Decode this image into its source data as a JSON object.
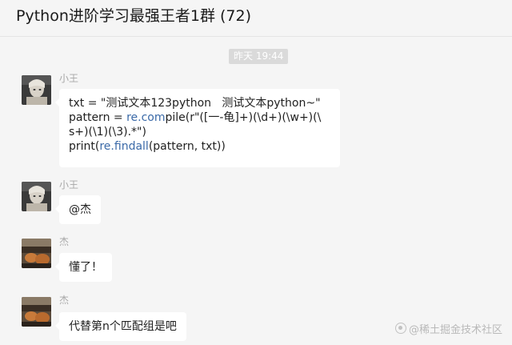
{
  "header": {
    "title": "Python进阶学习最强王者1群 (72)"
  },
  "time_divider": "昨天 19:44",
  "messages": [
    {
      "sender": "小王",
      "avatar": "user-avatar-xiaowang",
      "code": {
        "line1": "txt = \"测试文本123python   测试文本python~\"",
        "line2_pre": "pattern = ",
        "line2_link": "re.com",
        "line2_post": "pile(r\"([一-龟]+)(\\d+)(\\w+)(\\",
        "line3": "s+)(\\1)(\\3).*\")",
        "line4_pre": "print(",
        "line4_link": "re.findall",
        "line4_post": "(pattern, txt))"
      }
    },
    {
      "sender": "小王",
      "avatar": "user-avatar-xiaowang",
      "text": "@杰"
    },
    {
      "sender": "杰",
      "avatar": "user-avatar-jie",
      "text": "懂了！"
    },
    {
      "sender": "杰",
      "avatar": "user-avatar-jie",
      "text": "代替第n个匹配组是吧"
    }
  ],
  "watermark": "@稀土掘金技术社区",
  "colors": {
    "background": "#f5f5f5",
    "bubble": "#ffffff",
    "link": "#3b6aa8",
    "sender_name": "#a8a8a8"
  }
}
